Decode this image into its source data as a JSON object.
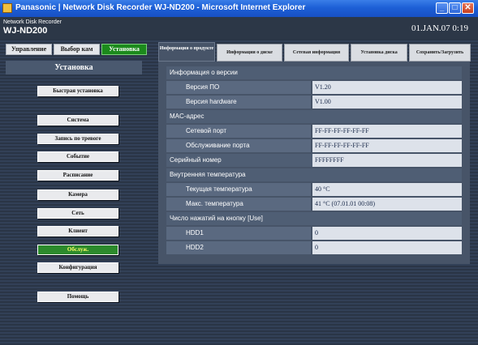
{
  "window": {
    "title": "Panasonic | Network Disk Recorder WJ-ND200 - Microsoft Internet Explorer",
    "icon": "ie-icon"
  },
  "header": {
    "subtitle": "Network Disk Recorder",
    "model": "WJ-ND200",
    "datetime": "01.JAN.07  0:19"
  },
  "nav_tabs": [
    {
      "label": "Управление",
      "active": false
    },
    {
      "label": "Выбор кам",
      "active": false
    },
    {
      "label": "Установка",
      "active": true
    }
  ],
  "section_title": "Установка",
  "menu": {
    "quick": "Быстрая установка",
    "system": "Система",
    "alarm_rec": "Запись по тревоге",
    "event": "Событие",
    "schedule": "Расписание",
    "camera": "Камера",
    "network": "Сеть",
    "client": "Клиент",
    "maintenance": "Обслуж.",
    "config": "Конфигурация",
    "help": "Помощь"
  },
  "content_tabs": {
    "product_info": "Информация о продукте",
    "disk_info": "Информация о диске",
    "network_info": "Сетевая информация",
    "disk_setup": "Установка диска",
    "save_load": "Сохранить/Загрузить"
  },
  "info": {
    "version_section": "Информация о версии",
    "sw_label": "Версия ПО",
    "sw_value": "V1.20",
    "hw_label": "Версия hardware",
    "hw_value": "V1.00",
    "mac_section": "MAC-адрес",
    "net_port_label": "Сетевой порт",
    "net_port_value": "FF-FF-FF-FF-FF-FF",
    "maint_port_label": "Обслуживание порта",
    "maint_port_value": "FF-FF-FF-FF-FF-FF",
    "serial_label": "Серийный номер",
    "serial_value": "FFFFFFFF",
    "temp_section": "Внутренняя температура",
    "cur_temp_label": "Текущая температура",
    "cur_temp_value": "40 °C",
    "max_temp_label": "Макс. температура",
    "max_temp_value": "41 °C (07.01.01  00:08)",
    "use_section": "Число нажатий на кнопку [Use]",
    "hdd1_label": "HDD1",
    "hdd1_value": "0",
    "hdd2_label": "HDD2",
    "hdd2_value": "0"
  }
}
